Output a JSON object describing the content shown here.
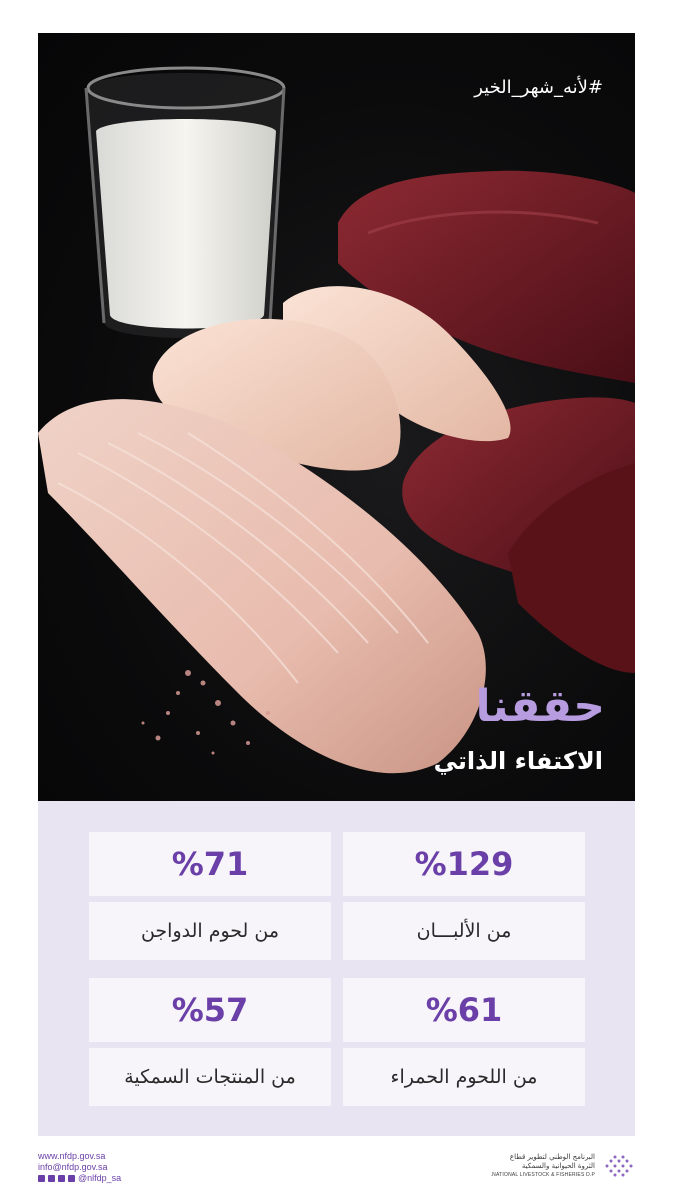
{
  "hero": {
    "hashtag": "#لأنه_شهر_الخير",
    "headline": "حققنا",
    "subheadline": "الاكتفاء الذاتي"
  },
  "stats": [
    {
      "value": "%129",
      "label": "من الألبـــان"
    },
    {
      "value": "%71",
      "label": "من لحوم الدواجن"
    },
    {
      "value": "%61",
      "label": "من اللحوم الحمراء"
    },
    {
      "value": "%57",
      "label": "من المنتجات السمكية"
    }
  ],
  "footer": {
    "website": "www.nfdp.gov.sa",
    "email": "info@nfdp.gov.sa",
    "social_handle": "@nlfdp_sa",
    "logo_ar_line1": "البرنامج الوطني لتطوير قطاع",
    "logo_ar_line2": "الثروة الحيوانية والسمكية",
    "logo_en": "NATIONAL LIVESTOCK & FISHERIES D.P."
  },
  "colors": {
    "accent": "#6a3fa7",
    "headline": "#b79ce0",
    "panel": "#e9e4f1"
  }
}
